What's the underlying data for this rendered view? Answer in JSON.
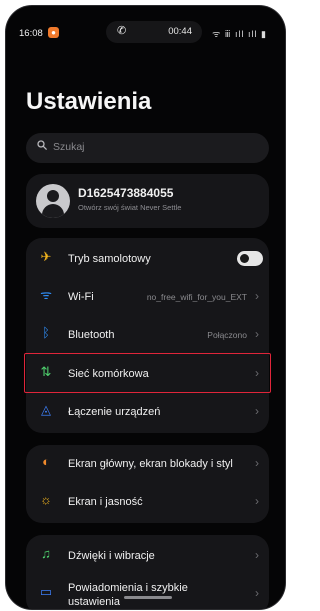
{
  "status_bar": {
    "time": "16:08",
    "call_time": "00:44",
    "app_icon_glyph": "●",
    "call_icon": "phone-icon",
    "right_icons": "ᯤ ⅲ ıll ıll ▮"
  },
  "page": {
    "title": "Ustawienia"
  },
  "search": {
    "placeholder": "Szukaj"
  },
  "account": {
    "name": "D1625473884055",
    "subtitle": "Otwórz swój świat Never Settle"
  },
  "group1": [
    {
      "label": "Tryb samolotowy",
      "icon": "airplane-icon",
      "glyph": "✈",
      "color": "#f3b51e",
      "toggle": false
    },
    {
      "label": "Wi-Fi",
      "icon": "wifi-icon",
      "glyph": "ᯤ",
      "color": "#2f8df5",
      "value": "no_free_wifi_for_you_EXT"
    },
    {
      "label": "Bluetooth",
      "icon": "bluetooth-icon",
      "glyph": "ᛒ",
      "color": "#2f8df5",
      "value": "Połączono"
    },
    {
      "label": "Sieć komórkowa",
      "icon": "mobile-network-icon",
      "glyph": "⇅",
      "color": "#4fd06e"
    },
    {
      "label": "Łączenie urządzeń",
      "icon": "device-connection-icon",
      "glyph": "◬",
      "color": "#3d7ef5"
    }
  ],
  "group2": [
    {
      "label": "Ekran główny, ekran blokady i styl",
      "icon": "palette-icon",
      "glyph": "◐",
      "color": "#f08a2c"
    },
    {
      "label": "Ekran i jasność",
      "icon": "brightness-icon",
      "glyph": "☼",
      "color": "#f3b51e"
    }
  ],
  "group3": [
    {
      "label": "Dźwięki i wibracje",
      "icon": "sound-vibration-icon",
      "glyph": "♫",
      "color": "#4fd06e"
    },
    {
      "label": "Powiadomienia i szybkie ustawienia",
      "icon": "notifications-icon",
      "glyph": "▭",
      "color": "#3d7ef5"
    }
  ],
  "chevron": "›",
  "highlight_color": "#e0253a"
}
